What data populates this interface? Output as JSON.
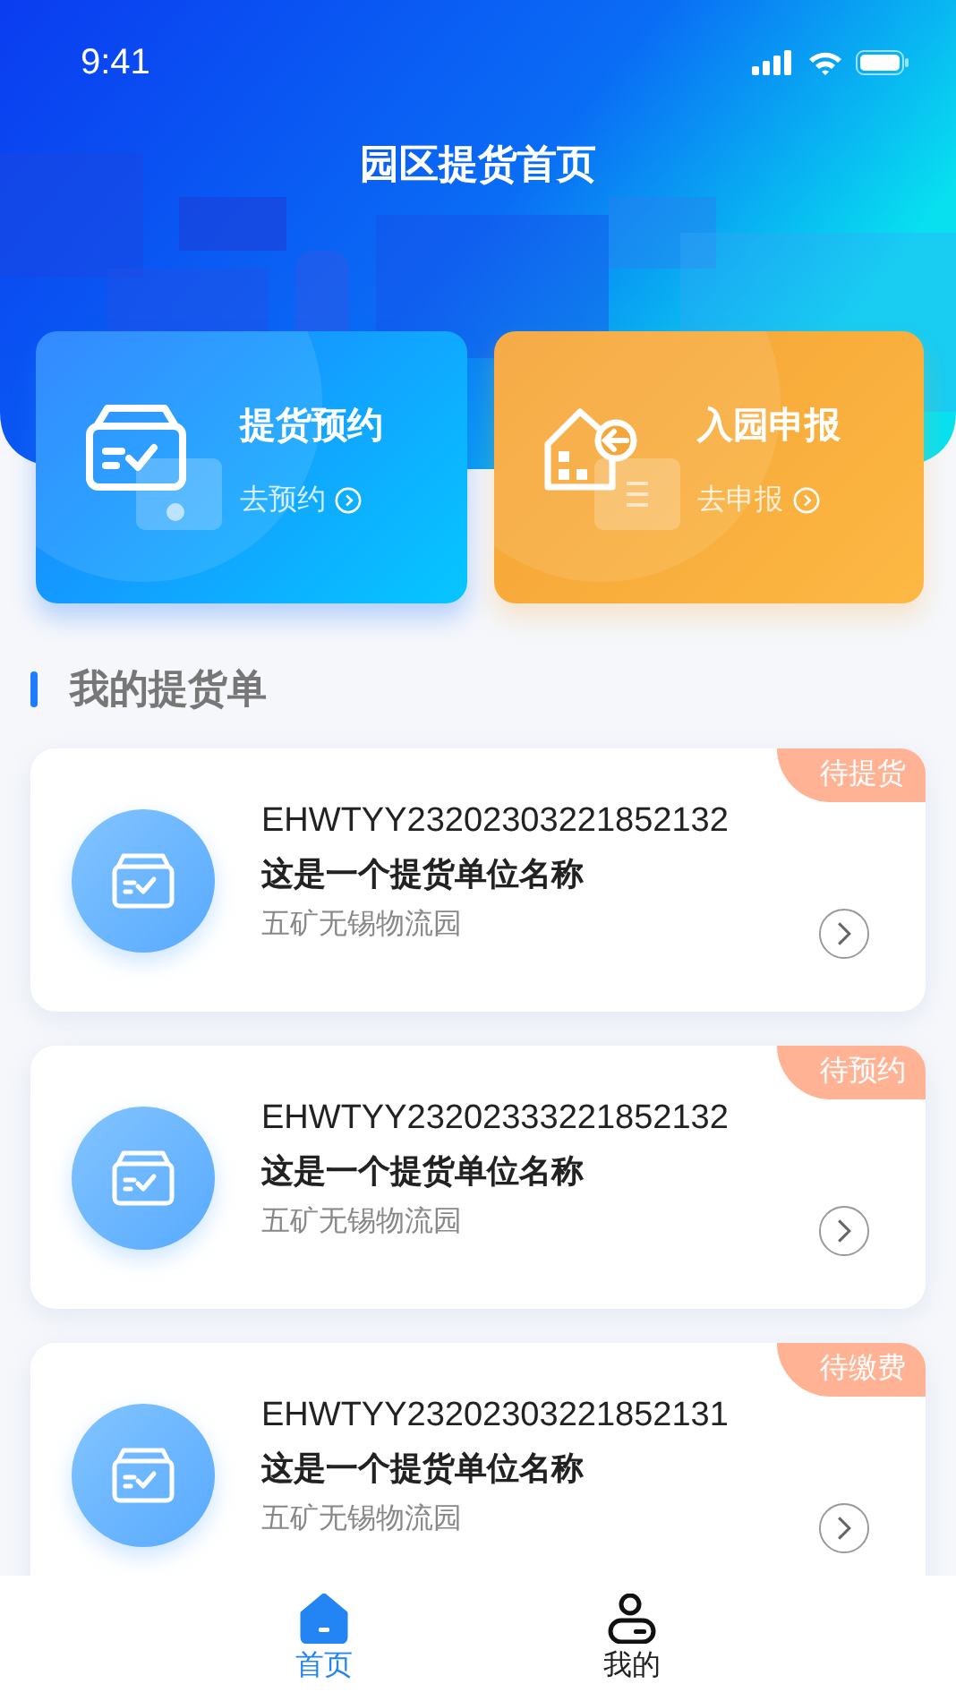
{
  "status_bar": {
    "time": "9:41"
  },
  "title": "园区提货首页",
  "actions": [
    {
      "kind": "pickup",
      "title": "提货预约",
      "link": "去预约"
    },
    {
      "kind": "declare",
      "title": "入园申报",
      "link": "去申报"
    }
  ],
  "section_title": "我的提货单",
  "orders": [
    {
      "number": "EHWTYY23202303221852132",
      "name": "这是一个提货单位名称",
      "park": "五矿无锡物流园",
      "status": "待提货"
    },
    {
      "number": "EHWTYY23202333221852132",
      "name": "这是一个提货单位名称",
      "park": "五矿无锡物流园",
      "status": "待预约"
    },
    {
      "number": "EHWTYY23202303221852131",
      "name": "这是一个提货单位名称",
      "park": "五矿无锡物流园",
      "status": "待缴费"
    }
  ],
  "tabs": [
    {
      "kind": "home",
      "label": "首页",
      "selected": true
    },
    {
      "kind": "me",
      "label": "我的",
      "selected": false
    }
  ]
}
